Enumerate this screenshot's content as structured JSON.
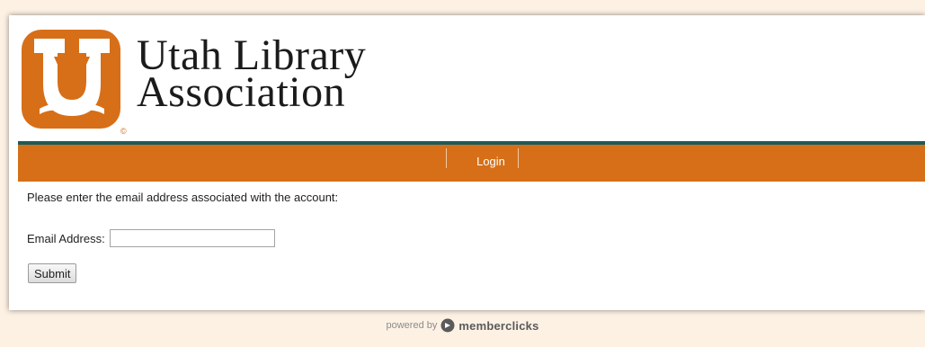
{
  "header": {
    "logo_line1": "Utah Library",
    "logo_line2": "Association",
    "logo_mark_icon": "utah-library-association-logo",
    "copyright_mark": "©",
    "brand_color": "#d66f18"
  },
  "nav": {
    "items": [
      {
        "label": "Login"
      }
    ],
    "bar_color": "#d66f18",
    "rule_color": "#1f5a55"
  },
  "form": {
    "instructions": "Please enter the email address associated with the account:",
    "email_label": "Email Address:",
    "email_value": "",
    "submit_label": "Submit"
  },
  "footer": {
    "powered_by": "powered by",
    "brand": "memberclicks",
    "brand_icon": "memberclicks-logo-icon"
  }
}
